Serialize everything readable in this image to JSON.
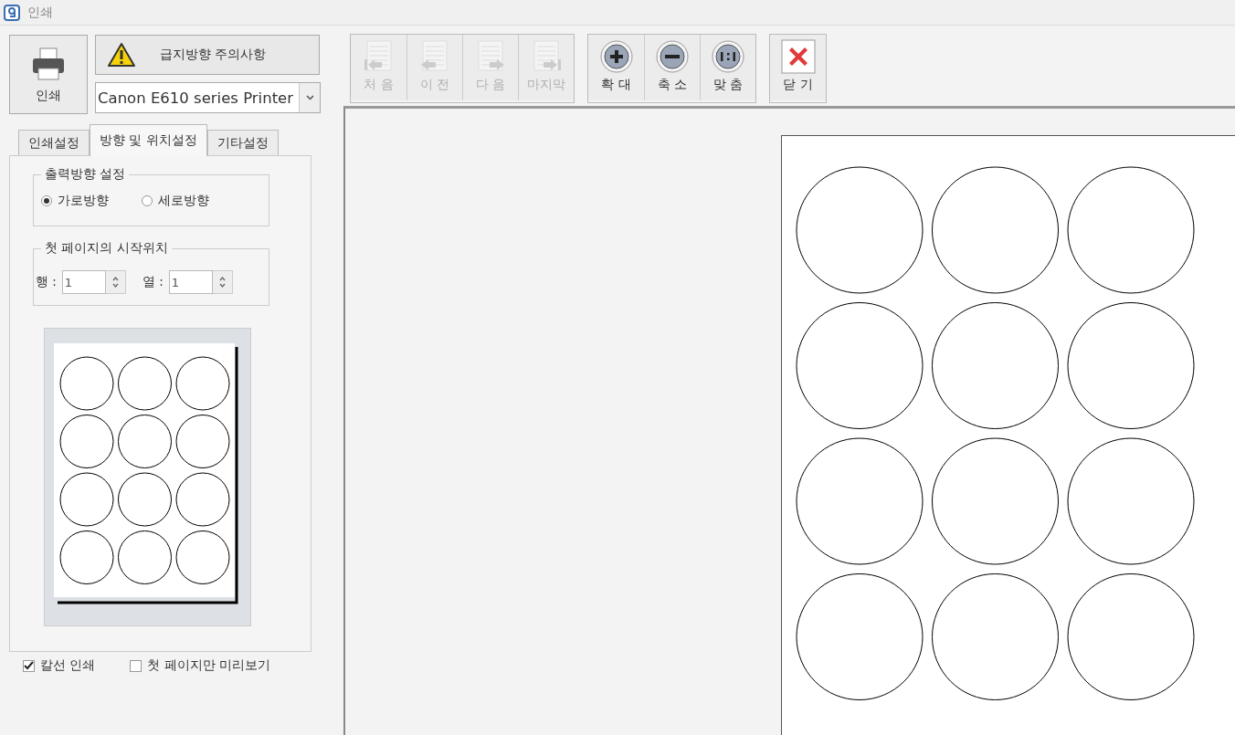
{
  "window": {
    "title": "인쇄"
  },
  "print_button": {
    "label": "인쇄"
  },
  "warning_button": {
    "label": "급지방향 주의사항"
  },
  "printer_select": {
    "value": "Canon E610 series Printer"
  },
  "tabs": [
    {
      "label": "인쇄설정",
      "selected": false
    },
    {
      "label": "방향 및 위치설정",
      "selected": true
    },
    {
      "label": "기타설정",
      "selected": false
    }
  ],
  "orientation": {
    "legend": "출력방향 설정",
    "options": [
      {
        "label": "가로방향",
        "selected": true
      },
      {
        "label": "세로방향",
        "selected": false
      }
    ]
  },
  "start_position": {
    "legend": "첫 페이지의 시작위치",
    "fields": [
      {
        "label": "행 :",
        "value": "1"
      },
      {
        "label": "열 :",
        "value": "1"
      }
    ]
  },
  "checkboxes": [
    {
      "label": "칼선 인쇄",
      "checked": true
    },
    {
      "label": "첫 페이지만 미리보기",
      "checked": false
    }
  ],
  "toolbar": [
    [
      {
        "kind": "first",
        "label": "처 음",
        "disabled": true
      },
      {
        "kind": "prev",
        "label": "이 전",
        "disabled": true
      },
      {
        "kind": "next",
        "label": "다 음",
        "disabled": true
      },
      {
        "kind": "last",
        "label": "마지막",
        "disabled": true
      }
    ],
    [
      {
        "kind": "zoom-in",
        "label": "확 대",
        "disabled": false
      },
      {
        "kind": "zoom-out",
        "label": "축 소",
        "disabled": false
      },
      {
        "kind": "fit",
        "label": "맞 춤",
        "disabled": false
      }
    ],
    [
      {
        "kind": "close",
        "label": "닫 기",
        "disabled": false
      }
    ]
  ]
}
